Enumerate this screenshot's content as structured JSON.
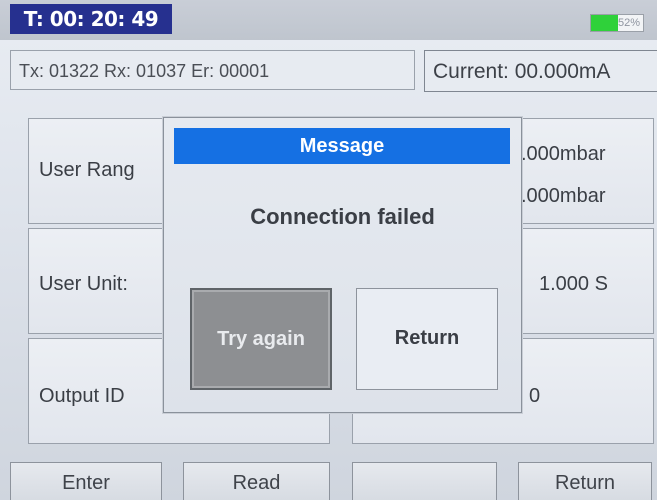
{
  "header": {
    "timer": "T: 00: 20: 49",
    "battery_label": "52%",
    "battery_level": 0.52,
    "battery_color": "#2fd13a"
  },
  "status": {
    "counters": "Tx: 01322 Rx: 01037 Er: 00001",
    "current": "Current: 00.000mA"
  },
  "rows": {
    "range": {
      "label": "User Rang",
      "value_1": ".000mbar",
      "value_2": ".000mbar"
    },
    "unit": {
      "label": "User Unit:",
      "value": "1.000 S"
    },
    "output": {
      "label": "Output ID",
      "value": "0"
    }
  },
  "softkeys": {
    "enter": "Enter",
    "read": "Read",
    "blank": "",
    "return": "Return"
  },
  "dialog": {
    "title": "Message",
    "message": "Connection failed",
    "try_again": "Try again",
    "return": "Return",
    "title_color": "#1570e3"
  }
}
